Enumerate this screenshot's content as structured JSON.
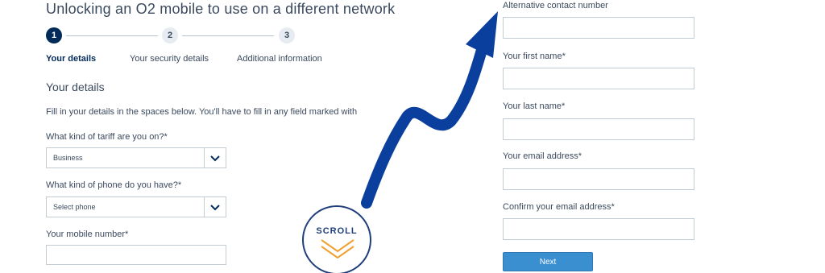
{
  "page": {
    "title": "Unlocking an O2 mobile to use on a different network"
  },
  "stepper": {
    "steps": [
      {
        "number": "1",
        "label": "Your details"
      },
      {
        "number": "2",
        "label": "Your security details"
      },
      {
        "number": "3",
        "label": "Additional information"
      }
    ]
  },
  "form": {
    "section_title": "Your details",
    "instructions": "Fill in your details in the spaces below. You'll have to fill in any field marked with",
    "tariff": {
      "label": "What kind of tariff are you on?*",
      "value": "Business"
    },
    "phone": {
      "label": "What kind of phone do you have?*",
      "value": "Select phone"
    },
    "mobile": {
      "label": "Your mobile number*",
      "value": ""
    },
    "alt_contact": {
      "label": "Alternative contact number",
      "value": ""
    },
    "first_name": {
      "label": "Your first name*",
      "value": ""
    },
    "last_name": {
      "label": "Your last name*",
      "value": ""
    },
    "email": {
      "label": "Your email address*",
      "value": ""
    },
    "confirm_email": {
      "label": "Confirm your email address*",
      "value": ""
    },
    "next_label": "Next"
  },
  "overlay": {
    "scroll_label": "SCROLL",
    "arrow_color": "#0b3f9e"
  },
  "colors": {
    "step_active": "#032b5a",
    "button": "#3a8fd1",
    "badge": "#1f3e7a"
  }
}
